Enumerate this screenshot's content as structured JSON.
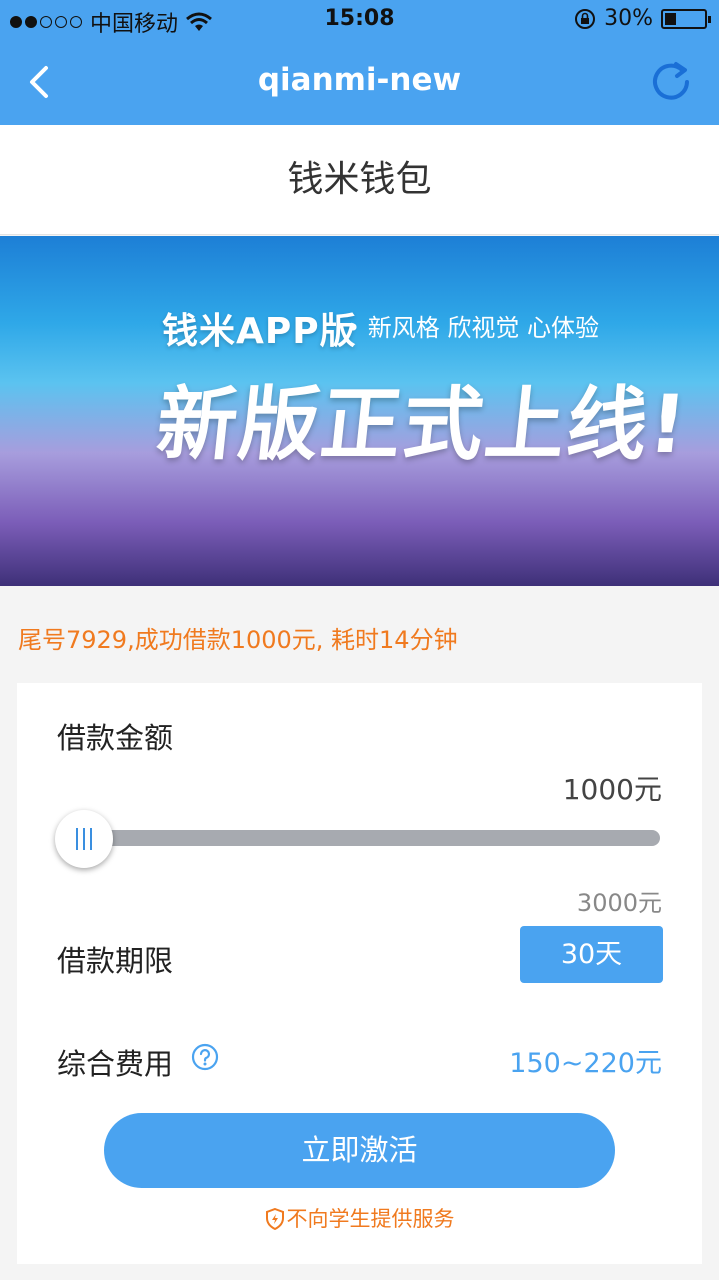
{
  "status_bar": {
    "carrier": "中国移动",
    "time": "15:08",
    "battery_text": "30%",
    "battery_level_percent": 30,
    "icons": [
      "signal-dots-icon",
      "wifi-icon",
      "orientation-lock-icon",
      "battery-icon"
    ]
  },
  "nav": {
    "title": "qianmi-new",
    "icons": [
      "chevron-left-icon",
      "refresh-icon"
    ],
    "accent": "#4aa3f0"
  },
  "page": {
    "title": "钱米钱包"
  },
  "banner": {
    "title": "钱米APP版",
    "subtitle": "• 新风格 欣视觉 心体验",
    "headline": "新版正式上线!"
  },
  "notice": {
    "text": "尾号7929,成功借款1000元, 耗时14分钟",
    "color": "#f07a1f"
  },
  "loan": {
    "amount_label": "借款金额",
    "amount_value": "1000元",
    "max_value": "3000元",
    "term_label": "借款期限",
    "term_value": "30天",
    "fee_label": "综合费用",
    "fee_value": "150~220元",
    "activate_label": "立即激活",
    "disclaimer": "不向学生提供服务"
  }
}
